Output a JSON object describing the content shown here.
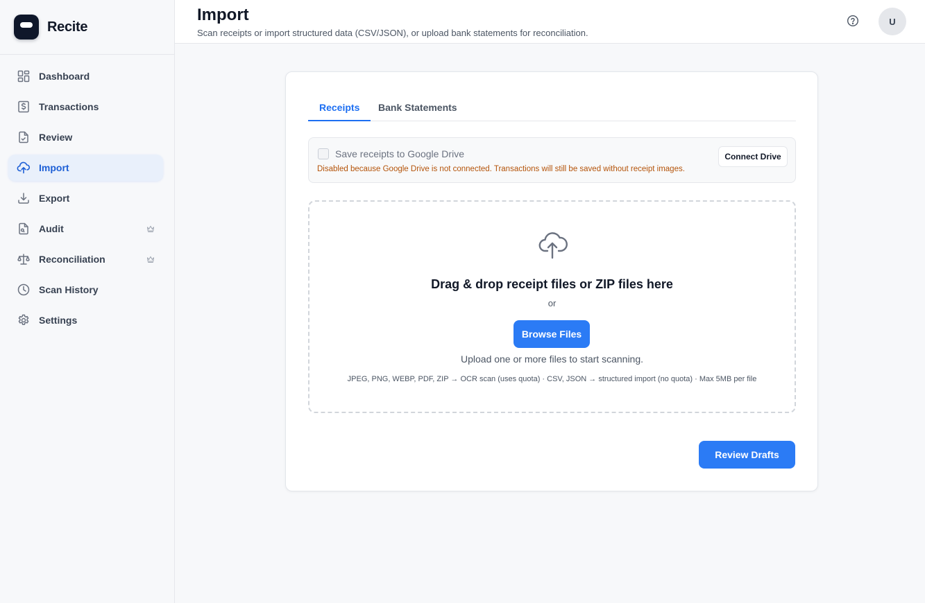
{
  "app": {
    "name": "Recite"
  },
  "sidebar": {
    "items": [
      {
        "label": "Dashboard",
        "icon": "dashboard-icon",
        "active": false,
        "premium": false
      },
      {
        "label": "Transactions",
        "icon": "dollar-document-icon",
        "active": false,
        "premium": false
      },
      {
        "label": "Review",
        "icon": "document-check-icon",
        "active": false,
        "premium": false
      },
      {
        "label": "Import",
        "icon": "cloud-upload-icon",
        "active": true,
        "premium": false
      },
      {
        "label": "Export",
        "icon": "download-icon",
        "active": false,
        "premium": false
      },
      {
        "label": "Audit",
        "icon": "document-search-icon",
        "active": false,
        "premium": true
      },
      {
        "label": "Reconciliation",
        "icon": "scale-icon",
        "active": false,
        "premium": true
      },
      {
        "label": "Scan History",
        "icon": "clock-icon",
        "active": false,
        "premium": false
      },
      {
        "label": "Settings",
        "icon": "gear-icon",
        "active": false,
        "premium": false
      }
    ]
  },
  "header": {
    "title": "Import",
    "subtitle": "Scan receipts or import structured data (CSV/JSON), or upload bank statements for reconciliation.",
    "avatar_initial": "U"
  },
  "tabs": [
    {
      "label": "Receipts",
      "active": true
    },
    {
      "label": "Bank Statements",
      "active": false
    }
  ],
  "drive": {
    "checkbox_label": "Save receipts to Google Drive",
    "checked": false,
    "warning": "Disabled because Google Drive is not connected. Transactions will still be saved without receipt images.",
    "connect_label": "Connect Drive"
  },
  "dropzone": {
    "title": "Drag & drop receipt files or ZIP files here",
    "or": "or",
    "browse_label": "Browse Files",
    "hint": "Upload one or more files to start scanning.",
    "formats": "JPEG, PNG, WEBP, PDF, ZIP → OCR scan (uses quota) · CSV, JSON → structured import (no quota) · Max 5MB per file"
  },
  "actions": {
    "review_drafts_label": "Review Drafts"
  },
  "colors": {
    "accent": "#2b7bf5",
    "active_nav_bg": "#e9f0fb",
    "warning": "#b45309"
  }
}
